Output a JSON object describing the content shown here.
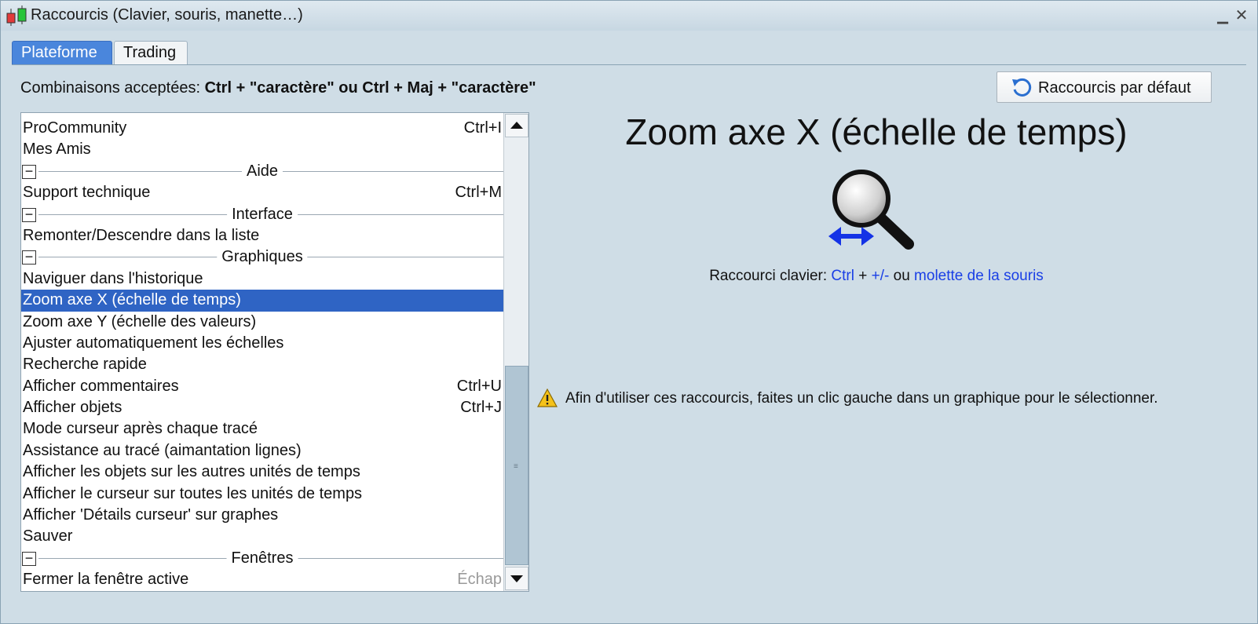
{
  "window": {
    "title": "Raccourcis (Clavier, souris, manette…)"
  },
  "tabs": [
    {
      "label": "Plateforme",
      "active": true
    },
    {
      "label": "Trading",
      "active": false
    }
  ],
  "combos": {
    "prefix": "Combinaisons acceptées: ",
    "bold": "Ctrl + \"caractère\" ou Ctrl + Maj + \"caractère\""
  },
  "reset_button": {
    "label": "Raccourcis par défaut"
  },
  "list": {
    "items": [
      {
        "type": "item",
        "label": "ProCommunity",
        "shortcut": "Ctrl+I"
      },
      {
        "type": "item",
        "label": "Mes Amis",
        "shortcut": ""
      },
      {
        "type": "group",
        "label": "Aide"
      },
      {
        "type": "item",
        "label": "Support technique",
        "shortcut": "Ctrl+M"
      },
      {
        "type": "group",
        "label": "Interface"
      },
      {
        "type": "item",
        "label": "Remonter/Descendre dans la liste",
        "shortcut": ""
      },
      {
        "type": "group",
        "label": "Graphiques"
      },
      {
        "type": "item",
        "label": "Naviguer dans l'historique",
        "shortcut": ""
      },
      {
        "type": "item",
        "label": "Zoom axe X (échelle de temps)",
        "shortcut": "",
        "selected": true
      },
      {
        "type": "item",
        "label": "Zoom axe Y (échelle des valeurs)",
        "shortcut": ""
      },
      {
        "type": "item",
        "label": "Ajuster automatiquement les échelles",
        "shortcut": ""
      },
      {
        "type": "item",
        "label": "Recherche rapide",
        "shortcut": ""
      },
      {
        "type": "item",
        "label": "Afficher commentaires",
        "shortcut": "Ctrl+U"
      },
      {
        "type": "item",
        "label": "Afficher objets",
        "shortcut": "Ctrl+J"
      },
      {
        "type": "item",
        "label": "Mode curseur après chaque tracé",
        "shortcut": ""
      },
      {
        "type": "item",
        "label": "Assistance au tracé (aimantation lignes)",
        "shortcut": ""
      },
      {
        "type": "item",
        "label": "Afficher les objets sur les autres unités de temps",
        "shortcut": ""
      },
      {
        "type": "item",
        "label": "Afficher le curseur sur toutes les unités de temps",
        "shortcut": ""
      },
      {
        "type": "item",
        "label": "Afficher 'Détails curseur' sur graphes",
        "shortcut": ""
      },
      {
        "type": "item",
        "label": "Sauver",
        "shortcut": ""
      },
      {
        "type": "group",
        "label": "Fenêtres"
      },
      {
        "type": "item",
        "label": "Fermer la fenêtre active",
        "shortcut": "Échap",
        "muted": true
      }
    ]
  },
  "detail": {
    "title": "Zoom axe X (échelle de temps)",
    "shortcut_prefix": "Raccourci clavier: ",
    "shortcut_key": "Ctrl",
    "shortcut_plus": " + ",
    "shortcut_key2": "+/-",
    "shortcut_or": " ou ",
    "shortcut_mouse": "molette de la souris",
    "warning": "Afin d'utiliser ces raccourcis, faites un clic gauche dans un graphique pour le sélectionner."
  },
  "colors": {
    "accent": "#2f64c4",
    "tab_active": "#4a86dc",
    "link": "#1a3fe6"
  }
}
